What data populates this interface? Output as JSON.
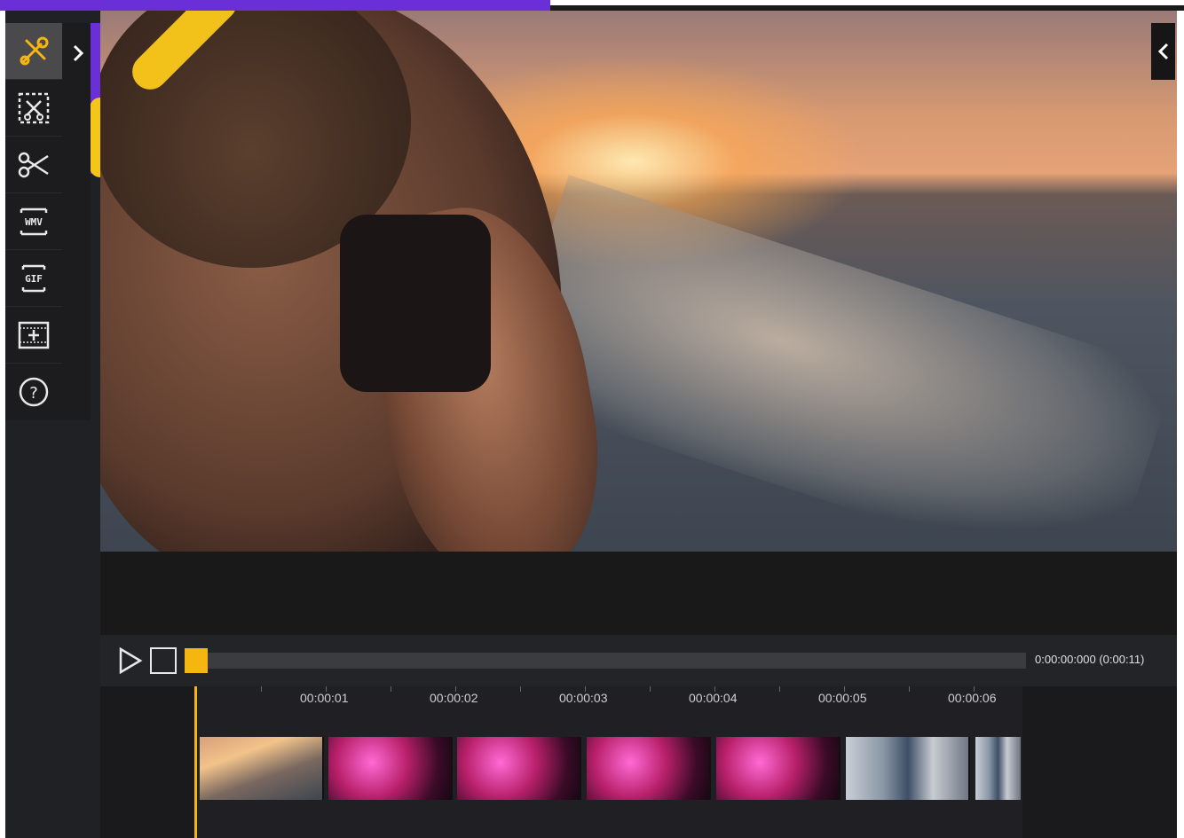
{
  "sidebar": {
    "tools": [
      {
        "name": "tools-icon",
        "label": ""
      },
      {
        "name": "crop-icon",
        "label": ""
      },
      {
        "name": "scissors-icon",
        "label": ""
      },
      {
        "name": "wmv-convert-icon",
        "label": "WMV"
      },
      {
        "name": "gif-convert-icon",
        "label": "GIF"
      },
      {
        "name": "add-media-icon",
        "label": ""
      },
      {
        "name": "help-icon",
        "label": "?"
      }
    ]
  },
  "player": {
    "time_current": "0:00:00:000",
    "time_total": "(0:00:11)"
  },
  "timeline": {
    "ruler": [
      "00:00:01",
      "00:00:02",
      "00:00:03",
      "00:00:04",
      "00:00:05",
      "00:00:06"
    ]
  },
  "colors": {
    "accent_yellow": "#f5b70f",
    "accent_purple": "#6a2fd6",
    "panel_dark": "#1c1c1e"
  }
}
